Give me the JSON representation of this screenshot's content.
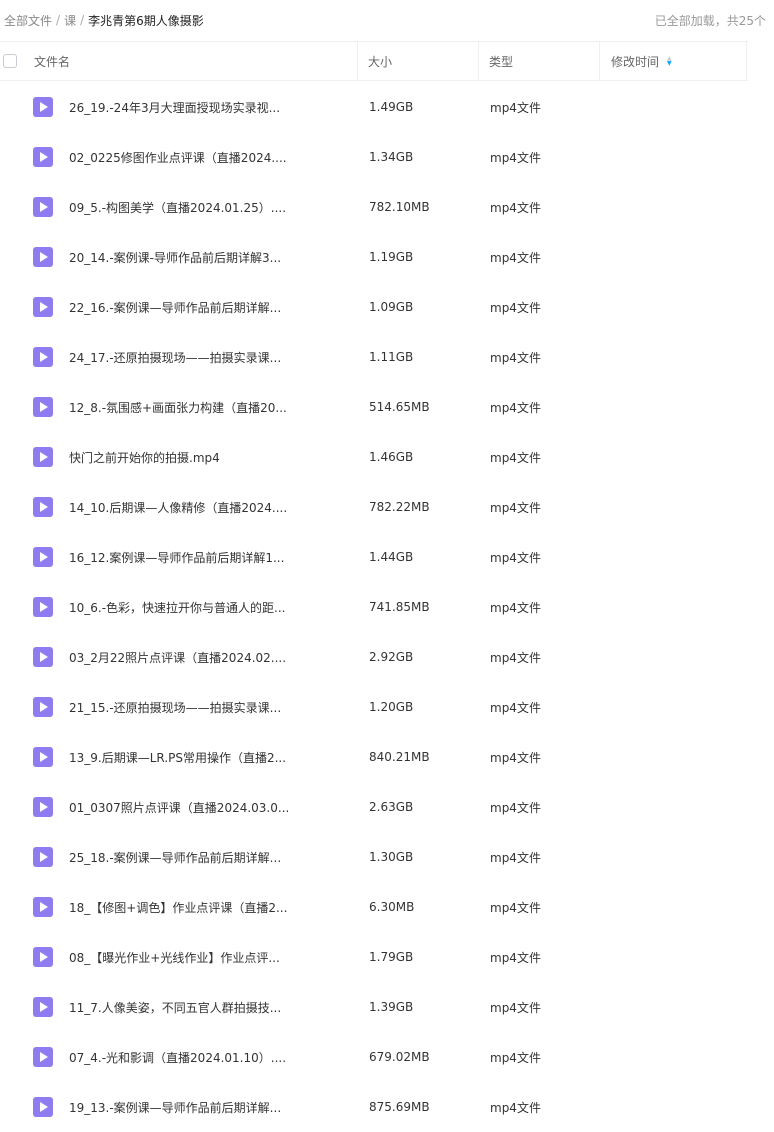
{
  "breadcrumb": {
    "items": [
      "全部文件",
      "课"
    ],
    "current": "李兆青第6期人像摄影",
    "separator": "/"
  },
  "status": {
    "loaded_text": "已全部加载，共25个"
  },
  "columns": {
    "name": "文件名",
    "size": "大小",
    "type": "类型",
    "modified": "修改时间"
  },
  "files": [
    {
      "name": "26_19.-24年3月大理面授现场实录视...",
      "size": "1.49GB",
      "type": "mp4文件"
    },
    {
      "name": "02_0225修图作业点评课（直播2024....",
      "size": "1.34GB",
      "type": "mp4文件"
    },
    {
      "name": "09_5.-构图美学（直播2024.01.25）....",
      "size": "782.10MB",
      "type": "mp4文件"
    },
    {
      "name": "20_14.-案例课-导师作品前后期详解3...",
      "size": "1.19GB",
      "type": "mp4文件"
    },
    {
      "name": "22_16.-案例课—导师作品前后期详解...",
      "size": "1.09GB",
      "type": "mp4文件"
    },
    {
      "name": "24_17.-还原拍摄现场——拍摄实录课...",
      "size": "1.11GB",
      "type": "mp4文件"
    },
    {
      "name": "12_8.-氛围感+画面张力构建（直播20...",
      "size": "514.65MB",
      "type": "mp4文件"
    },
    {
      "name": "快门之前开始你的拍摄.mp4",
      "size": "1.46GB",
      "type": "mp4文件"
    },
    {
      "name": "14_10.后期课—人像精修（直播2024....",
      "size": "782.22MB",
      "type": "mp4文件"
    },
    {
      "name": "16_12.案例课—导师作品前后期详解1...",
      "size": "1.44GB",
      "type": "mp4文件"
    },
    {
      "name": "10_6.-色彩，快速拉开你与普通人的距...",
      "size": "741.85MB",
      "type": "mp4文件"
    },
    {
      "name": "03_2月22照片点评课（直播2024.02....",
      "size": "2.92GB",
      "type": "mp4文件"
    },
    {
      "name": "21_15.-还原拍摄现场——拍摄实录课...",
      "size": "1.20GB",
      "type": "mp4文件"
    },
    {
      "name": "13_9.后期课—LR.PS常用操作（直播2...",
      "size": "840.21MB",
      "type": "mp4文件"
    },
    {
      "name": "01_0307照片点评课（直播2024.03.0...",
      "size": "2.63GB",
      "type": "mp4文件"
    },
    {
      "name": "25_18.-案例课—导师作品前后期详解...",
      "size": "1.30GB",
      "type": "mp4文件"
    },
    {
      "name": "18_【修图+调色】作业点评课（直播2...",
      "size": "6.30MB",
      "type": "mp4文件"
    },
    {
      "name": "08_【曝光作业+光线作业】作业点评...",
      "size": "1.79GB",
      "type": "mp4文件"
    },
    {
      "name": "11_7.人像美姿，不同五官人群拍摄技...",
      "size": "1.39GB",
      "type": "mp4文件"
    },
    {
      "name": "07_4.-光和影调（直播2024.01.10）....",
      "size": "679.02MB",
      "type": "mp4文件"
    },
    {
      "name": "19_13.-案例课—导师作品前后期详解...",
      "size": "875.69MB",
      "type": "mp4文件"
    }
  ],
  "colors": {
    "file_icon": "#8e7cf0",
    "sort_active": "#06a7ff"
  },
  "icons": {
    "file": "video-file-icon",
    "sort": "sort-icon"
  }
}
